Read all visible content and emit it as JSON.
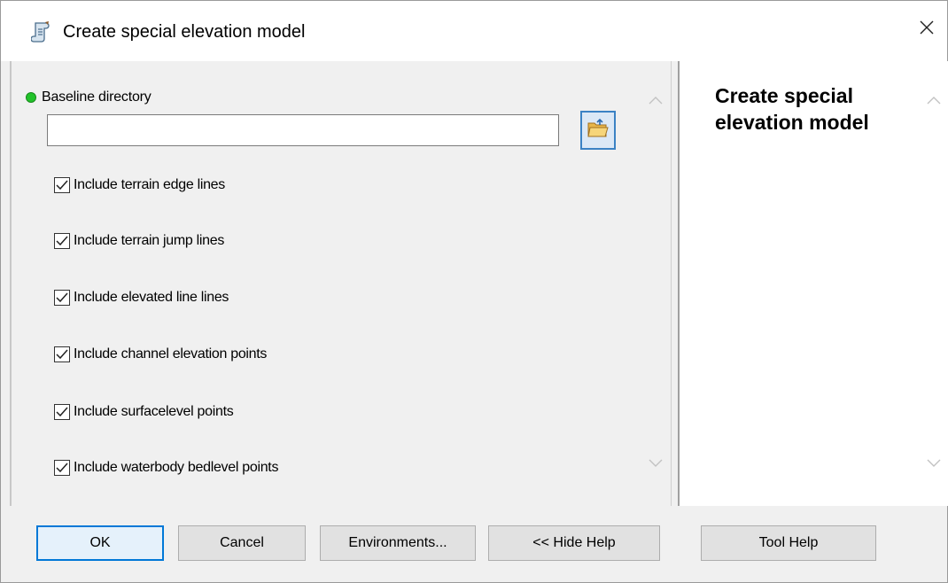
{
  "window": {
    "title": "Create special elevation model",
    "close_glyph": "✕"
  },
  "form": {
    "baseline_label": "Baseline directory",
    "baseline_value": "",
    "status_color": "#22c22a",
    "options": [
      {
        "label": "Include terrain edge lines",
        "checked": true
      },
      {
        "label": "Include terrain jump lines",
        "checked": true
      },
      {
        "label": "Include elevated line lines",
        "checked": true
      },
      {
        "label": "Include channel elevation points",
        "checked": true
      },
      {
        "label": "Include surfacelevel points",
        "checked": true
      },
      {
        "label": "Include waterbody bedlevel points",
        "checked": true
      }
    ]
  },
  "help": {
    "title": "Create special elevation model"
  },
  "buttons": {
    "ok": "OK",
    "cancel": "Cancel",
    "environments": "Environments...",
    "hide_help": "<< Hide Help",
    "tool_help": "Tool Help"
  },
  "icons": {
    "title": "tool-scroll-icon",
    "browse": "open-folder-icon",
    "close": "close-icon"
  }
}
